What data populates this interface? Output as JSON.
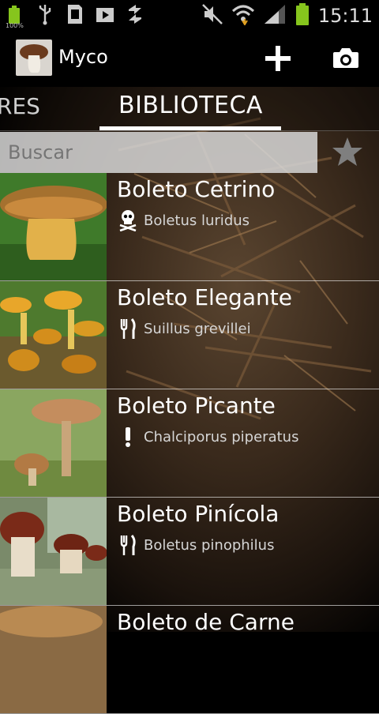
{
  "status": {
    "battery_pct_label": "100%",
    "time": "15:11"
  },
  "app": {
    "title": "Myco"
  },
  "tabs": {
    "prev": "RES",
    "active": "BIBLIOTECA"
  },
  "search": {
    "placeholder": "Buscar"
  },
  "items": [
    {
      "name": "Boleto Cetrino",
      "scientific": "Boletus luridus",
      "edibility_icon": "skull-icon"
    },
    {
      "name": "Boleto Elegante",
      "scientific": "Suillus grevillei",
      "edibility_icon": "fork-knife-icon"
    },
    {
      "name": "Boleto Picante",
      "scientific": "Chalciporus piperatus",
      "edibility_icon": "exclamation-icon"
    },
    {
      "name": "Boleto Pinícola",
      "scientific": "Boletus pinophilus",
      "edibility_icon": "fork-knife-icon"
    },
    {
      "name": "Boleto de Carne",
      "scientific": "",
      "edibility_icon": ""
    }
  ],
  "colors": {
    "battery": "#86c51d",
    "wifi_arrow": "#e0a020",
    "tab_indicator": "#ffffff"
  }
}
